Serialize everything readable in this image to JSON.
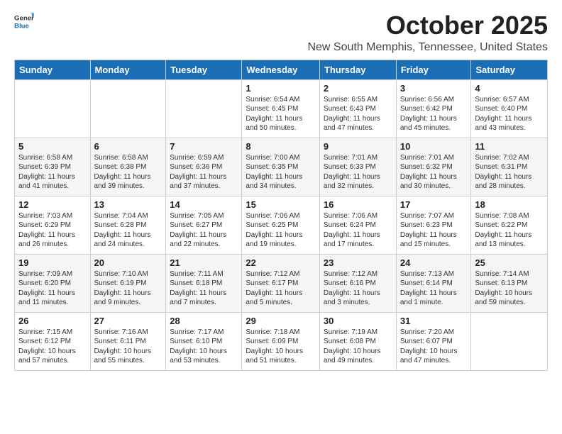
{
  "logo": {
    "general": "General",
    "blue": "Blue"
  },
  "title": "October 2025",
  "location": "New South Memphis, Tennessee, United States",
  "weekdays": [
    "Sunday",
    "Monday",
    "Tuesday",
    "Wednesday",
    "Thursday",
    "Friday",
    "Saturday"
  ],
  "weeks": [
    [
      {
        "day": "",
        "sunrise": "",
        "sunset": "",
        "daylight": ""
      },
      {
        "day": "",
        "sunrise": "",
        "sunset": "",
        "daylight": ""
      },
      {
        "day": "",
        "sunrise": "",
        "sunset": "",
        "daylight": ""
      },
      {
        "day": "1",
        "sunrise": "Sunrise: 6:54 AM",
        "sunset": "Sunset: 6:45 PM",
        "daylight": "Daylight: 11 hours and 50 minutes."
      },
      {
        "day": "2",
        "sunrise": "Sunrise: 6:55 AM",
        "sunset": "Sunset: 6:43 PM",
        "daylight": "Daylight: 11 hours and 47 minutes."
      },
      {
        "day": "3",
        "sunrise": "Sunrise: 6:56 AM",
        "sunset": "Sunset: 6:42 PM",
        "daylight": "Daylight: 11 hours and 45 minutes."
      },
      {
        "day": "4",
        "sunrise": "Sunrise: 6:57 AM",
        "sunset": "Sunset: 6:40 PM",
        "daylight": "Daylight: 11 hours and 43 minutes."
      }
    ],
    [
      {
        "day": "5",
        "sunrise": "Sunrise: 6:58 AM",
        "sunset": "Sunset: 6:39 PM",
        "daylight": "Daylight: 11 hours and 41 minutes."
      },
      {
        "day": "6",
        "sunrise": "Sunrise: 6:58 AM",
        "sunset": "Sunset: 6:38 PM",
        "daylight": "Daylight: 11 hours and 39 minutes."
      },
      {
        "day": "7",
        "sunrise": "Sunrise: 6:59 AM",
        "sunset": "Sunset: 6:36 PM",
        "daylight": "Daylight: 11 hours and 37 minutes."
      },
      {
        "day": "8",
        "sunrise": "Sunrise: 7:00 AM",
        "sunset": "Sunset: 6:35 PM",
        "daylight": "Daylight: 11 hours and 34 minutes."
      },
      {
        "day": "9",
        "sunrise": "Sunrise: 7:01 AM",
        "sunset": "Sunset: 6:33 PM",
        "daylight": "Daylight: 11 hours and 32 minutes."
      },
      {
        "day": "10",
        "sunrise": "Sunrise: 7:01 AM",
        "sunset": "Sunset: 6:32 PM",
        "daylight": "Daylight: 11 hours and 30 minutes."
      },
      {
        "day": "11",
        "sunrise": "Sunrise: 7:02 AM",
        "sunset": "Sunset: 6:31 PM",
        "daylight": "Daylight: 11 hours and 28 minutes."
      }
    ],
    [
      {
        "day": "12",
        "sunrise": "Sunrise: 7:03 AM",
        "sunset": "Sunset: 6:29 PM",
        "daylight": "Daylight: 11 hours and 26 minutes."
      },
      {
        "day": "13",
        "sunrise": "Sunrise: 7:04 AM",
        "sunset": "Sunset: 6:28 PM",
        "daylight": "Daylight: 11 hours and 24 minutes."
      },
      {
        "day": "14",
        "sunrise": "Sunrise: 7:05 AM",
        "sunset": "Sunset: 6:27 PM",
        "daylight": "Daylight: 11 hours and 22 minutes."
      },
      {
        "day": "15",
        "sunrise": "Sunrise: 7:06 AM",
        "sunset": "Sunset: 6:25 PM",
        "daylight": "Daylight: 11 hours and 19 minutes."
      },
      {
        "day": "16",
        "sunrise": "Sunrise: 7:06 AM",
        "sunset": "Sunset: 6:24 PM",
        "daylight": "Daylight: 11 hours and 17 minutes."
      },
      {
        "day": "17",
        "sunrise": "Sunrise: 7:07 AM",
        "sunset": "Sunset: 6:23 PM",
        "daylight": "Daylight: 11 hours and 15 minutes."
      },
      {
        "day": "18",
        "sunrise": "Sunrise: 7:08 AM",
        "sunset": "Sunset: 6:22 PM",
        "daylight": "Daylight: 11 hours and 13 minutes."
      }
    ],
    [
      {
        "day": "19",
        "sunrise": "Sunrise: 7:09 AM",
        "sunset": "Sunset: 6:20 PM",
        "daylight": "Daylight: 11 hours and 11 minutes."
      },
      {
        "day": "20",
        "sunrise": "Sunrise: 7:10 AM",
        "sunset": "Sunset: 6:19 PM",
        "daylight": "Daylight: 11 hours and 9 minutes."
      },
      {
        "day": "21",
        "sunrise": "Sunrise: 7:11 AM",
        "sunset": "Sunset: 6:18 PM",
        "daylight": "Daylight: 11 hours and 7 minutes."
      },
      {
        "day": "22",
        "sunrise": "Sunrise: 7:12 AM",
        "sunset": "Sunset: 6:17 PM",
        "daylight": "Daylight: 11 hours and 5 minutes."
      },
      {
        "day": "23",
        "sunrise": "Sunrise: 7:12 AM",
        "sunset": "Sunset: 6:16 PM",
        "daylight": "Daylight: 11 hours and 3 minutes."
      },
      {
        "day": "24",
        "sunrise": "Sunrise: 7:13 AM",
        "sunset": "Sunset: 6:14 PM",
        "daylight": "Daylight: 11 hours and 1 minute."
      },
      {
        "day": "25",
        "sunrise": "Sunrise: 7:14 AM",
        "sunset": "Sunset: 6:13 PM",
        "daylight": "Daylight: 10 hours and 59 minutes."
      }
    ],
    [
      {
        "day": "26",
        "sunrise": "Sunrise: 7:15 AM",
        "sunset": "Sunset: 6:12 PM",
        "daylight": "Daylight: 10 hours and 57 minutes."
      },
      {
        "day": "27",
        "sunrise": "Sunrise: 7:16 AM",
        "sunset": "Sunset: 6:11 PM",
        "daylight": "Daylight: 10 hours and 55 minutes."
      },
      {
        "day": "28",
        "sunrise": "Sunrise: 7:17 AM",
        "sunset": "Sunset: 6:10 PM",
        "daylight": "Daylight: 10 hours and 53 minutes."
      },
      {
        "day": "29",
        "sunrise": "Sunrise: 7:18 AM",
        "sunset": "Sunset: 6:09 PM",
        "daylight": "Daylight: 10 hours and 51 minutes."
      },
      {
        "day": "30",
        "sunrise": "Sunrise: 7:19 AM",
        "sunset": "Sunset: 6:08 PM",
        "daylight": "Daylight: 10 hours and 49 minutes."
      },
      {
        "day": "31",
        "sunrise": "Sunrise: 7:20 AM",
        "sunset": "Sunset: 6:07 PM",
        "daylight": "Daylight: 10 hours and 47 minutes."
      },
      {
        "day": "",
        "sunrise": "",
        "sunset": "",
        "daylight": ""
      }
    ]
  ]
}
